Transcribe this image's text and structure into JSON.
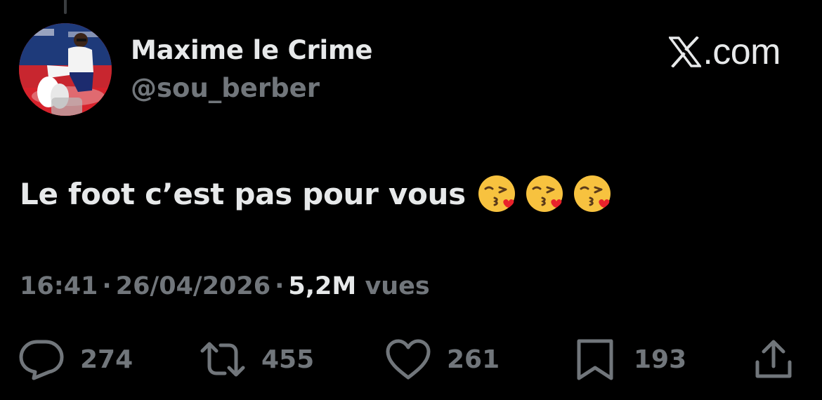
{
  "tweet": {
    "display_name": "Maxime le Crime",
    "handle": "@sou_berber",
    "text": "Le foot c’est pas pour vous",
    "emojis": [
      "face-throwing-a-kiss-emoji",
      "face-throwing-a-kiss-emoji",
      "face-throwing-a-kiss-emoji"
    ],
    "time": "16:41",
    "date": "26/04/2026",
    "views_count": "5,2M",
    "views_label": "vues",
    "separator": "·"
  },
  "brand": {
    "suffix": ".com",
    "logo_icon": "x-logo-icon"
  },
  "actions": {
    "replies": "274",
    "reposts": "455",
    "likes": "261",
    "bookmarks": "193"
  },
  "colors": {
    "background": "#000000",
    "primary_text": "#e7e9ea",
    "secondary_text": "#71767b"
  }
}
